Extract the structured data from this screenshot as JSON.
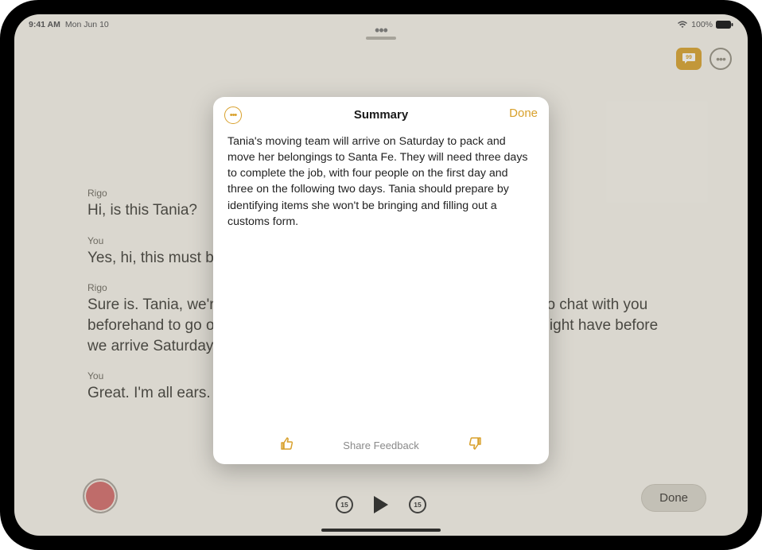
{
  "status": {
    "time": "9:41 AM",
    "date": "Mon Jun 10",
    "battery": "100%"
  },
  "toolbar": {
    "skip_seconds": "15"
  },
  "transcript": {
    "items": [
      {
        "speaker": "Rigo",
        "text": "Hi, is this Tania?"
      },
      {
        "speaker": "You",
        "text": "Yes, hi, this must be Rigo from the moving company."
      },
      {
        "speaker": "Rigo",
        "text": "Sure is. Tania, we're all set for your move on Saturday, but I wanted to chat with you beforehand to go over some details and answer any questions you might have before we arrive Saturday morning."
      },
      {
        "speaker": "You",
        "text": "Great. I'm all ears."
      }
    ]
  },
  "bottom": {
    "done_label": "Done"
  },
  "modal": {
    "title": "Summary",
    "done_label": "Done",
    "body": "Tania's moving team will arrive on Saturday to pack and move her belongings to Santa Fe. They will need three days to complete the job, with four people on the first day and three on the following two days. Tania should prepare by identifying items she won't be bringing and filling out a customs form.",
    "feedback_label": "Share Feedback"
  }
}
